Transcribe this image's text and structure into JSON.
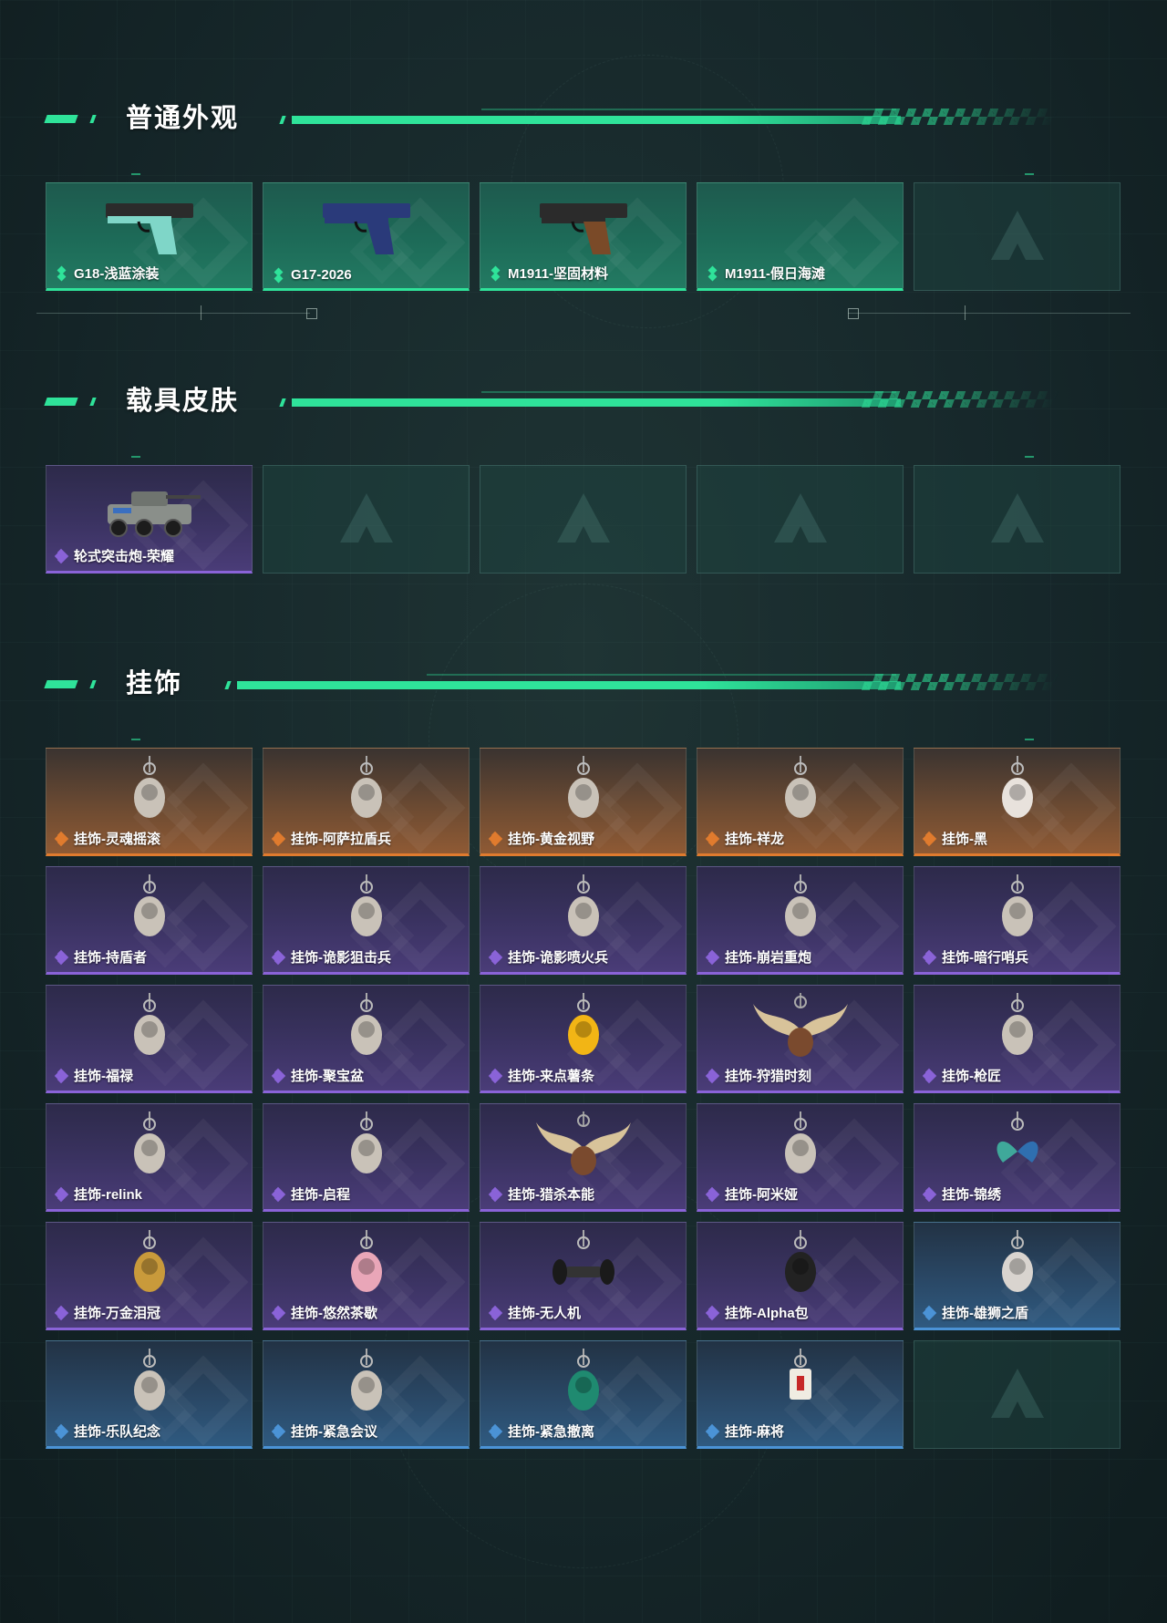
{
  "colors": {
    "accent": "#2fe39a",
    "rarity_green": "#2fe39a",
    "rarity_purple": "#8a63d8",
    "rarity_orange": "#e07b2e",
    "rarity_blue": "#4b93d6"
  },
  "sections": [
    {
      "title": "普通外观",
      "items": [
        {
          "label": "G18-浅蓝涂装",
          "rarity": "green",
          "icon": "pistol-teal-icon"
        },
        {
          "label": "G17-2026",
          "rarity": "green",
          "icon": "pistol-navy-icon"
        },
        {
          "label": "M1911-坚固材料",
          "rarity": "green",
          "icon": "pistol-brown-icon"
        },
        {
          "label": "M1911-假日海滩",
          "rarity": "green",
          "icon": null
        },
        {
          "label": null,
          "rarity": "empty",
          "icon": null
        }
      ]
    },
    {
      "title": "载具皮肤",
      "items": [
        {
          "label": "轮式突击炮-荣耀",
          "rarity": "purple",
          "icon": "armored-vehicle-icon"
        },
        {
          "label": null,
          "rarity": "empty",
          "icon": null
        },
        {
          "label": null,
          "rarity": "empty",
          "icon": null
        },
        {
          "label": null,
          "rarity": "empty",
          "icon": null
        },
        {
          "label": null,
          "rarity": "empty",
          "icon": null
        }
      ]
    },
    {
      "title": "挂饰",
      "items": [
        {
          "label": "挂饰-灵魂摇滚",
          "rarity": "orange",
          "icon": "charm-figure-icon"
        },
        {
          "label": "挂饰-阿萨拉盾兵",
          "rarity": "orange",
          "icon": "charm-figure-icon"
        },
        {
          "label": "挂饰-黄金视野",
          "rarity": "orange",
          "icon": "charm-figure-icon"
        },
        {
          "label": "挂饰-祥龙",
          "rarity": "orange",
          "icon": "charm-dragon-icon"
        },
        {
          "label": "挂饰-黑",
          "rarity": "orange",
          "icon": "charm-bottle-icon"
        },
        {
          "label": "挂饰-持盾者",
          "rarity": "purple",
          "icon": "charm-figure-icon"
        },
        {
          "label": "挂饰-诡影狙击兵",
          "rarity": "purple",
          "icon": "charm-figure-icon"
        },
        {
          "label": "挂饰-诡影喷火兵",
          "rarity": "purple",
          "icon": "charm-figure-icon"
        },
        {
          "label": "挂饰-崩岩重炮",
          "rarity": "purple",
          "icon": "charm-figure-icon"
        },
        {
          "label": "挂饰-暗行哨兵",
          "rarity": "purple",
          "icon": "charm-figure-icon"
        },
        {
          "label": "挂饰-福禄",
          "rarity": "purple",
          "icon": "charm-gourd-icon"
        },
        {
          "label": "挂饰-聚宝盆",
          "rarity": "purple",
          "icon": "charm-bowl-icon"
        },
        {
          "label": "挂饰-来点薯条",
          "rarity": "purple",
          "icon": "charm-fries-icon"
        },
        {
          "label": "挂饰-狩猎时刻",
          "rarity": "purple",
          "icon": "charm-antlers-icon"
        },
        {
          "label": "挂饰-枪匠",
          "rarity": "purple",
          "icon": "charm-plate-icon"
        },
        {
          "label": "挂饰-relink",
          "rarity": "purple",
          "icon": "charm-ring-icon"
        },
        {
          "label": "挂饰-启程",
          "rarity": "purple",
          "icon": "charm-ring-icon"
        },
        {
          "label": "挂饰-猎杀本能",
          "rarity": "purple",
          "icon": "charm-antlers-icon"
        },
        {
          "label": "挂饰-阿米娅",
          "rarity": "purple",
          "icon": "charm-figure-icon"
        },
        {
          "label": "挂饰-锦绣",
          "rarity": "purple",
          "icon": "charm-butterfly-icon"
        },
        {
          "label": "挂饰-万金泪冠",
          "rarity": "purple",
          "icon": "charm-burger-icon"
        },
        {
          "label": "挂饰-悠然茶歇",
          "rarity": "purple",
          "icon": "charm-cupcake-icon"
        },
        {
          "label": "挂饰-无人机",
          "rarity": "purple",
          "icon": "charm-drone-icon"
        },
        {
          "label": "挂饰-Alpha包",
          "rarity": "purple",
          "icon": "charm-pack-icon"
        },
        {
          "label": "挂饰-雄狮之盾",
          "rarity": "blue",
          "icon": "charm-shield-icon"
        },
        {
          "label": "挂饰-乐队纪念",
          "rarity": "blue",
          "icon": "charm-badge-icon"
        },
        {
          "label": "挂饰-紧急会议",
          "rarity": "blue",
          "icon": "charm-figure-icon"
        },
        {
          "label": "挂饰-紧急撤离",
          "rarity": "blue",
          "icon": "charm-frame-icon"
        },
        {
          "label": "挂饰-麻将",
          "rarity": "blue",
          "icon": "charm-mahjong-icon"
        },
        {
          "label": null,
          "rarity": "empty",
          "icon": null
        }
      ]
    }
  ]
}
